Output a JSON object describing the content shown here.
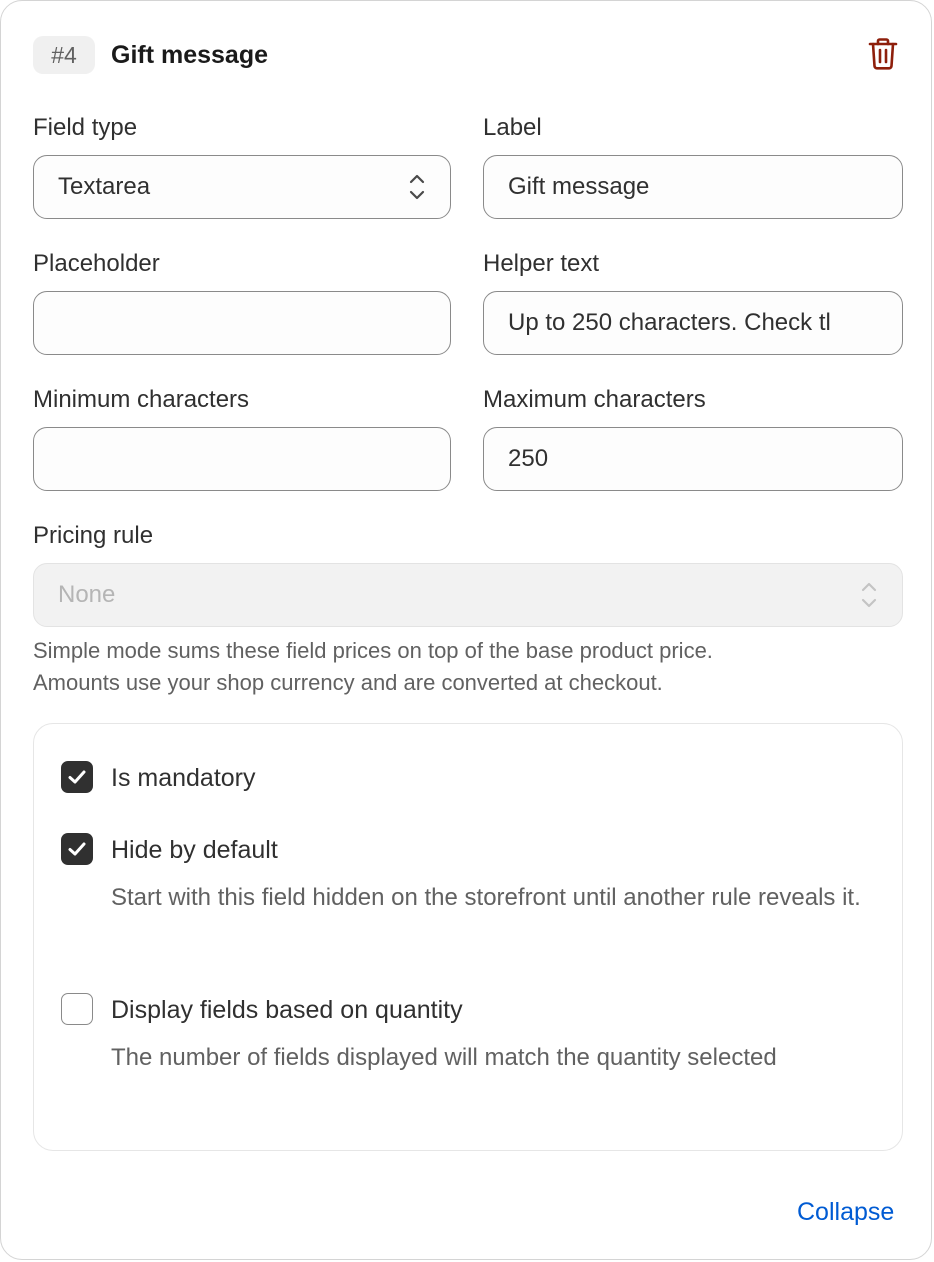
{
  "header": {
    "badge": "#4",
    "title": "Gift message",
    "delete_icon": "trash-icon",
    "delete_color": "#8e1f0b"
  },
  "fields": {
    "field_type": {
      "label": "Field type",
      "value": "Textarea"
    },
    "label": {
      "label": "Label",
      "value": "Gift message"
    },
    "placeholder": {
      "label": "Placeholder",
      "value": ""
    },
    "helper_text": {
      "label": "Helper text",
      "value": "Up to 250 characters. Check tl"
    },
    "min_chars": {
      "label": "Minimum characters",
      "value": ""
    },
    "max_chars": {
      "label": "Maximum characters",
      "value": "250"
    },
    "pricing_rule": {
      "label": "Pricing rule",
      "value": "None",
      "help_line1": "Simple mode sums these field prices on top of the base product price.",
      "help_line2": "Amounts use your shop currency and are converted at checkout."
    }
  },
  "options": {
    "mandatory": {
      "label": "Is mandatory",
      "checked": true
    },
    "hide_default": {
      "label": "Hide by default",
      "checked": true,
      "desc": "Start with this field hidden on the storefront until another rule reveals it."
    },
    "by_quantity": {
      "label": "Display fields based on quantity",
      "checked": false,
      "desc": "The number of fields displayed will match the quantity selected"
    }
  },
  "footer": {
    "collapse_label": "Collapse",
    "link_color": "#005bd3"
  }
}
